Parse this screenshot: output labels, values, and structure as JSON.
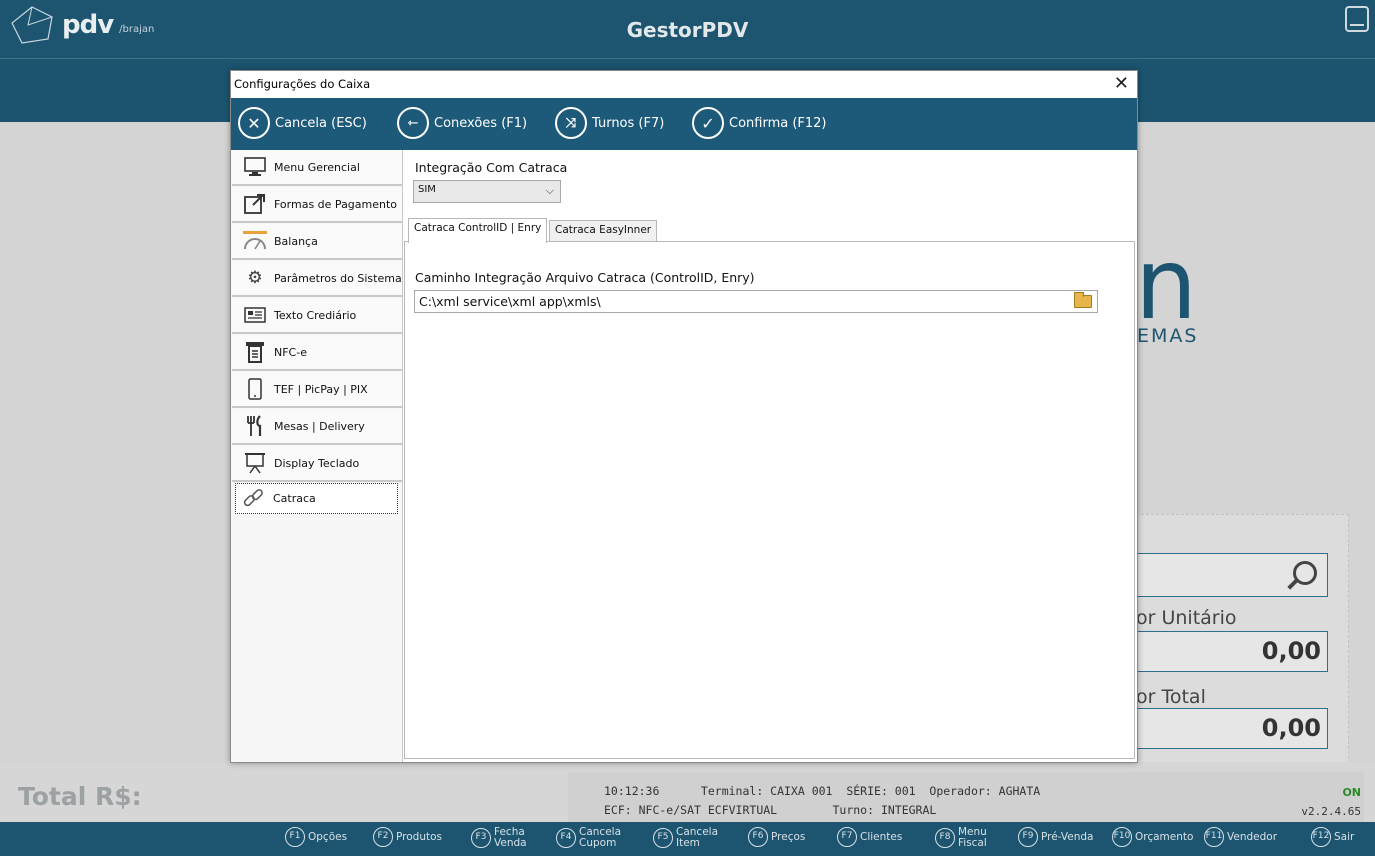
{
  "app": {
    "logo_text": "pdv",
    "logo_sub": "/brajan",
    "title": "GestorPDV",
    "bg_logo_letter": "n",
    "bg_logo_sub": "EMAS"
  },
  "background_panel": {
    "unit_label": "or Unitário",
    "unit_value": "0,00",
    "total_label": "or Total",
    "total_value": "0,00"
  },
  "footer": {
    "total_label": "Total R$:",
    "status_line1": "10:12:36      Terminal: CAIXA 001  SÉRIE: 001  Operador: AGHATA",
    "status_line2": "ECF: NFC-e/SAT ECFVIRTUAL        Turno: INTEGRAL",
    "online": "ON",
    "version": "v2.2.4.65",
    "fkeys": [
      {
        "key": "F1",
        "label": "Opções"
      },
      {
        "key": "F2",
        "label": "Produtos"
      },
      {
        "key": "F3",
        "label": "Fecha\nVenda"
      },
      {
        "key": "F4",
        "label": "Cancela\nCupom"
      },
      {
        "key": "F5",
        "label": "Cancela\nItem"
      },
      {
        "key": "F6",
        "label": "Preços"
      },
      {
        "key": "F7",
        "label": "Clientes"
      },
      {
        "key": "F8",
        "label": "Menu\nFiscal"
      },
      {
        "key": "F9",
        "label": "Pré-Venda"
      },
      {
        "key": "F10",
        "label": "Orçamento"
      },
      {
        "key": "F11",
        "label": "Vendedor"
      },
      {
        "key": "F12",
        "label": "Sair"
      }
    ]
  },
  "dialog": {
    "title": "Configurações do Caixa",
    "close": "✕",
    "toolbar": {
      "cancel": "Cancela (ESC)",
      "connections": "Conexões (F1)",
      "shifts": "Turnos (F7)",
      "confirm": "Confirma (F12)"
    },
    "menu": [
      {
        "label": "Menu Gerencial",
        "icon": "monitor-icon"
      },
      {
        "label": "Formas de Pagamento",
        "icon": "external-link-icon"
      },
      {
        "label": "Balança",
        "icon": "gauge-icon"
      },
      {
        "label": "Parâmetros do Sistema",
        "icon": "gears-icon"
      },
      {
        "label": "Texto Crediário",
        "icon": "id-card-icon"
      },
      {
        "label": "NFC-e",
        "icon": "receipt-icon"
      },
      {
        "label": "TEF | PicPay | PIX",
        "icon": "phone-icon"
      },
      {
        "label": "Mesas | Delivery",
        "icon": "cutlery-icon"
      },
      {
        "label": "Display Teclado",
        "icon": "presentation-icon"
      },
      {
        "label": "Catraca",
        "icon": "link-icon"
      }
    ],
    "selected_menu": "Catraca",
    "content": {
      "integration_label": "Integração Com Catraca",
      "integration_value": "SIM",
      "tabs": [
        "Catraca ControlID | Enry",
        "Catraca EasyInner"
      ],
      "active_tab": "Catraca ControlID | Enry",
      "path_label": "Caminho Integração Arquivo Catraca (ControlID, Enry)",
      "path_value": "C:\\xml service\\xml app\\xmls\\"
    }
  },
  "colors": {
    "brand": "#1d5571",
    "toolbar": "#1d5a79",
    "online": "#2a8a2a"
  }
}
